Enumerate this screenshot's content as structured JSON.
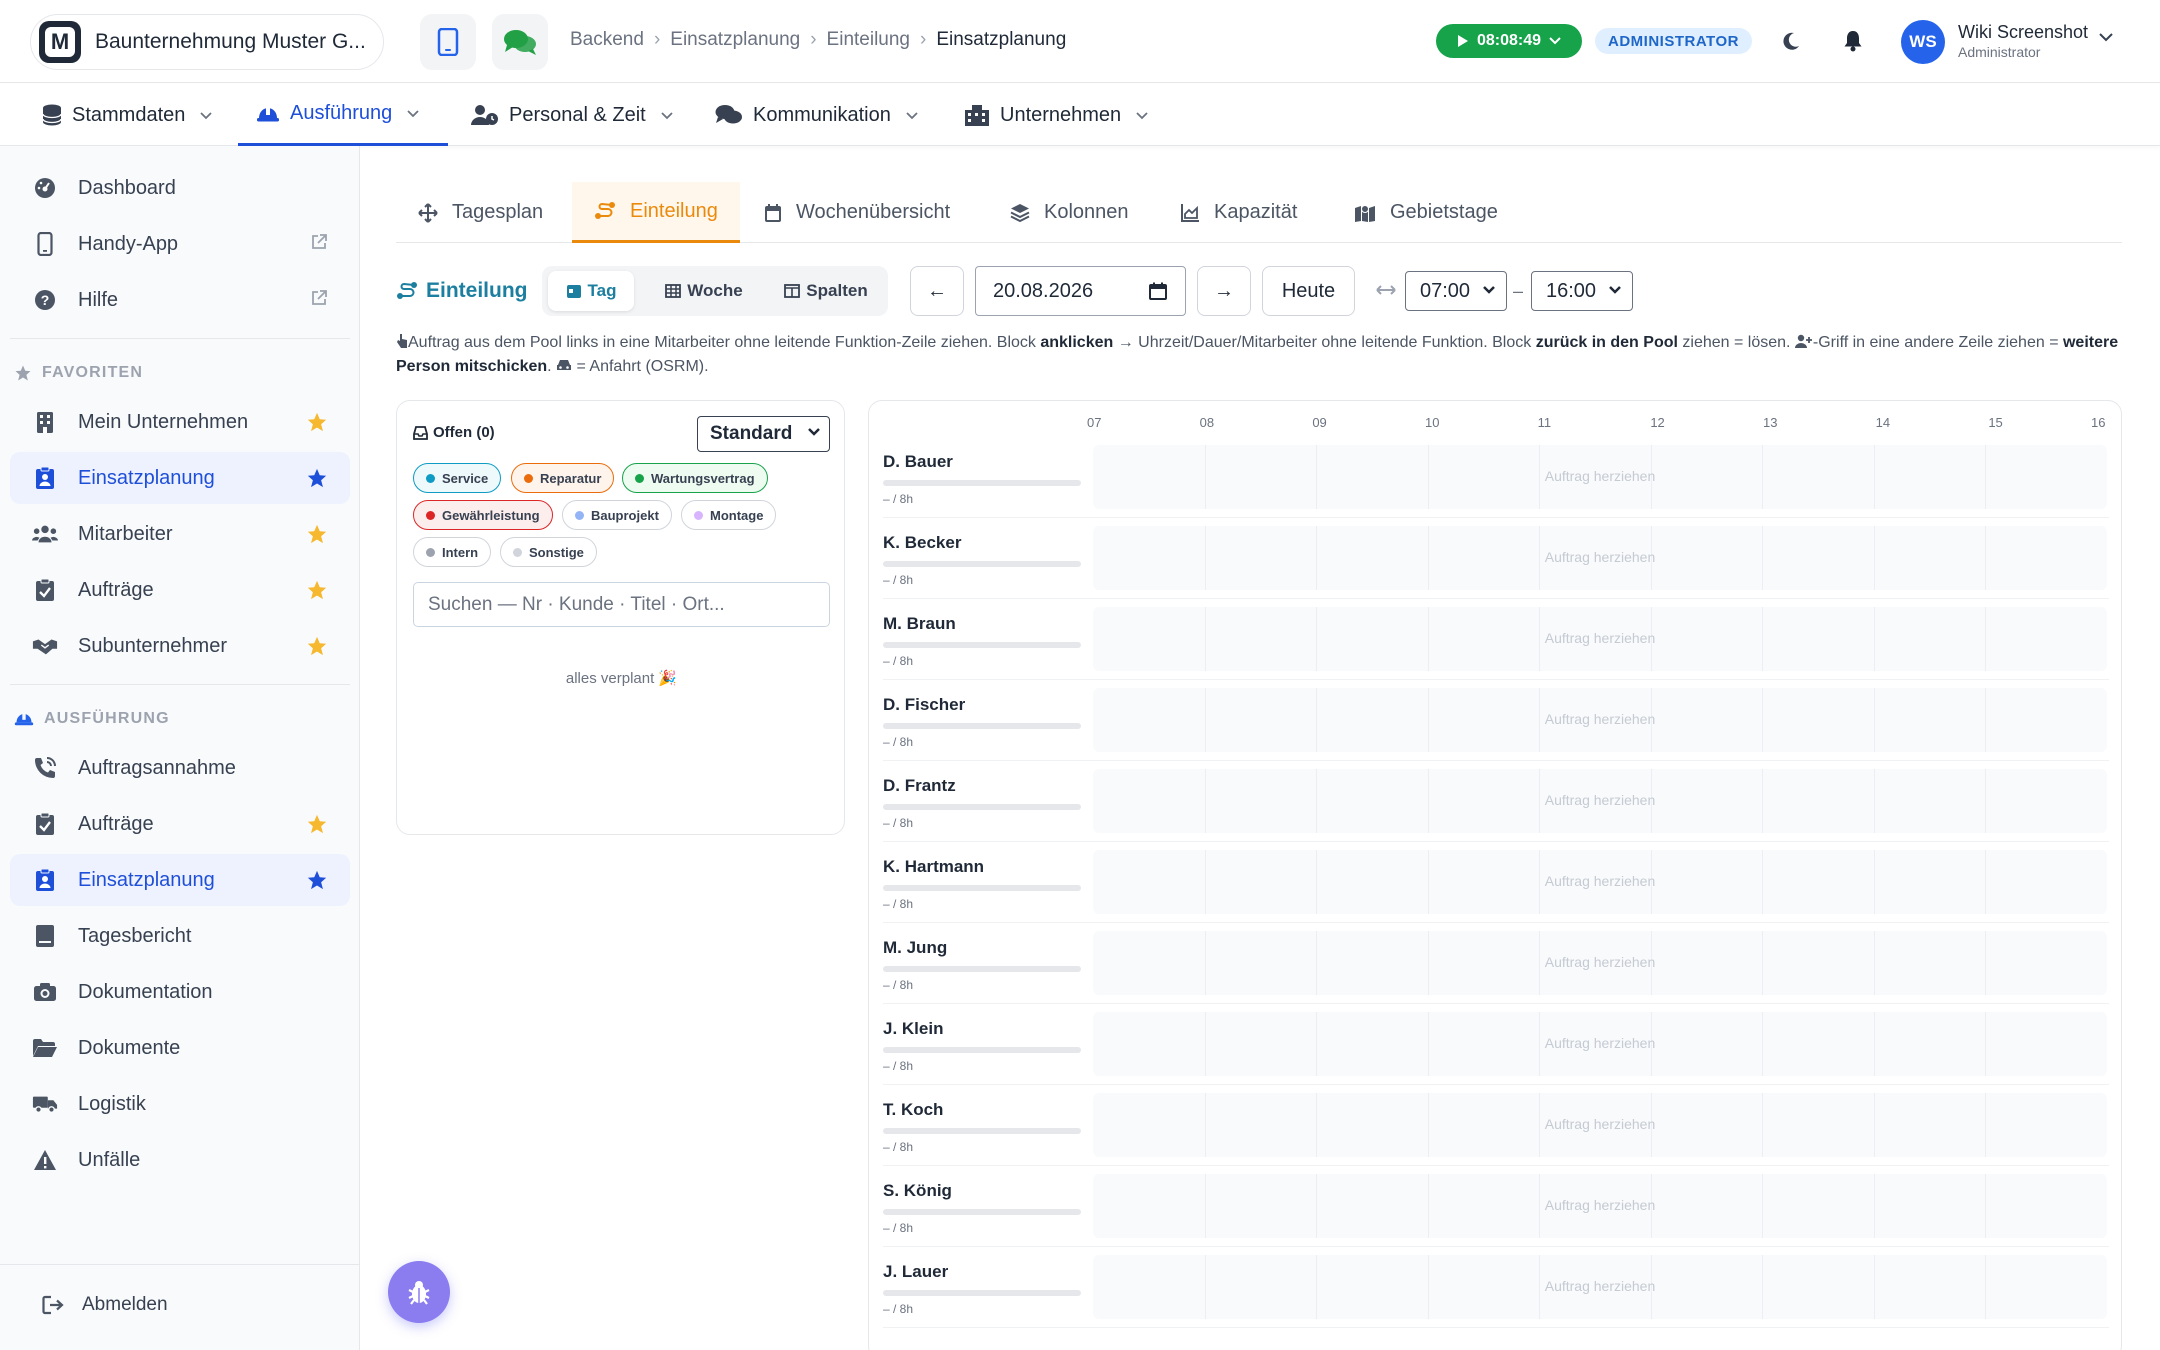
{
  "app": {
    "company_name": "Baunternehmung Muster G...",
    "logo_letter": "M"
  },
  "breadcrumb": [
    "Backend",
    "Einsatzplanung",
    "Einteilung",
    "Einsatzplanung"
  ],
  "header": {
    "timer": "08:08:49",
    "role_badge": "ADMINISTRATOR",
    "user_initials": "WS",
    "user_name": "Wiki Screenshot",
    "user_role": "Administrator"
  },
  "mainnav": [
    {
      "label": "Stammdaten",
      "icon": "database-icon",
      "active": false
    },
    {
      "label": "Ausführung",
      "icon": "helmet-icon",
      "active": true
    },
    {
      "label": "Personal & Zeit",
      "icon": "user-clock-icon",
      "active": false
    },
    {
      "label": "Kommunikation",
      "icon": "comments-icon",
      "active": false
    },
    {
      "label": "Unternehmen",
      "icon": "building-icon",
      "active": false
    }
  ],
  "sidebar": {
    "top": [
      {
        "label": "Dashboard",
        "icon": "gauge-icon"
      },
      {
        "label": "Handy-App",
        "icon": "phone-icon",
        "external": true
      },
      {
        "label": "Hilfe",
        "icon": "question-icon",
        "external": true
      }
    ],
    "favorites_heading": "FAVORITEN",
    "favorites": [
      {
        "label": "Mein Unternehmen",
        "icon": "building-icon",
        "star": "gold"
      },
      {
        "label": "Einsatzplanung",
        "icon": "clipboard-user-icon",
        "star": "blue",
        "active": true
      },
      {
        "label": "Mitarbeiter",
        "icon": "users-icon",
        "star": "gold"
      },
      {
        "label": "Aufträge",
        "icon": "clipboard-check-icon",
        "star": "gold"
      },
      {
        "label": "Subunternehmer",
        "icon": "handshake-icon",
        "star": "gold"
      }
    ],
    "section_heading": "AUSFÜHRUNG",
    "section": [
      {
        "label": "Auftragsannahme",
        "icon": "phone-volume-icon"
      },
      {
        "label": "Aufträge",
        "icon": "clipboard-check-icon",
        "star": "gold"
      },
      {
        "label": "Einsatzplanung",
        "icon": "clipboard-user-icon",
        "star": "blue",
        "active": true
      },
      {
        "label": "Tagesbericht",
        "icon": "report-icon"
      },
      {
        "label": "Dokumentation",
        "icon": "camera-icon"
      },
      {
        "label": "Dokumente",
        "icon": "folder-icon"
      },
      {
        "label": "Logistik",
        "icon": "truck-icon"
      },
      {
        "label": "Unfälle",
        "icon": "warning-icon"
      }
    ],
    "logout": "Abmelden"
  },
  "tabs": [
    {
      "label": "Tagesplan",
      "icon": "arrows-icon",
      "active": false
    },
    {
      "label": "Einteilung",
      "icon": "route-icon",
      "active": true
    },
    {
      "label": "Wochenübersicht",
      "icon": "calendar-icon",
      "active": false
    },
    {
      "label": "Kolonnen",
      "icon": "layers-icon",
      "active": false
    },
    {
      "label": "Kapazität",
      "icon": "chart-area-icon",
      "active": false
    },
    {
      "label": "Gebietstage",
      "icon": "map-icon",
      "active": false
    }
  ],
  "toolbar": {
    "title": "Einteilung",
    "views": [
      {
        "label": "Tag",
        "active": true
      },
      {
        "label": "Woche",
        "active": false
      },
      {
        "label": "Spalten",
        "active": false
      }
    ],
    "prev": "←",
    "date": "20.08.2026",
    "next": "→",
    "today": "Heute",
    "time_from": "07:00",
    "time_sep": "–",
    "time_to": "16:00"
  },
  "hint": {
    "p1": "Auftrag aus dem Pool links in eine Mitarbeiter ohne leitende Funktion-Zeile ziehen. Block ",
    "b1": "anklicken",
    "p2": " → Uhrzeit/Dauer/Mitarbeiter ohne leitende Funktion. Block ",
    "b2": "zurück in den Pool",
    "p3": " ziehen = lösen. ",
    "p4": "-Griff in eine andere Zeile ziehen = ",
    "b3": "weitere Person mitschicken",
    "p5": ". ",
    "p6": " = Anfahrt (OSRM)."
  },
  "pool": {
    "title": "Offen (0)",
    "filter": "Standard",
    "chips": [
      {
        "label": "Service",
        "color": "#0e9cc4",
        "border": "#0e9cc4",
        "bg": "#eef9fc"
      },
      {
        "label": "Reparatur",
        "color": "#ea6c0c",
        "border": "#ea6c0c",
        "bg": "#fff4ec"
      },
      {
        "label": "Wartungsvertrag",
        "color": "#16a34a",
        "border": "#16a34a",
        "bg": "#edfbf1"
      },
      {
        "label": "Gewährleistung",
        "color": "#dc2626",
        "border": "#dc2626",
        "bg": "#fdeeee"
      },
      {
        "label": "Bauprojekt",
        "color": "#93b4f5",
        "border": "#d1d5db",
        "bg": "#ffffff"
      },
      {
        "label": "Montage",
        "color": "#d8b4fe",
        "border": "#d1d5db",
        "bg": "#ffffff"
      },
      {
        "label": "Intern",
        "color": "#9ca3af",
        "border": "#d1d5db",
        "bg": "#ffffff"
      },
      {
        "label": "Sonstige",
        "color": "#d1d5db",
        "border": "#d1d5db",
        "bg": "#ffffff"
      }
    ],
    "search_placeholder": "Suchen — Nr · Kunde · Titel · Ort...",
    "empty": "alles verplant 🎉"
  },
  "schedule": {
    "hours": [
      "07",
      "08",
      "09",
      "10",
      "11",
      "12",
      "13",
      "14",
      "15",
      "16"
    ],
    "drop_label": "Auftrag herziehen",
    "employees": [
      {
        "name": "D. Bauer",
        "hours": "– / 8h"
      },
      {
        "name": "K. Becker",
        "hours": "– / 8h"
      },
      {
        "name": "M. Braun",
        "hours": "– / 8h"
      },
      {
        "name": "D. Fischer",
        "hours": "– / 8h"
      },
      {
        "name": "D. Frantz",
        "hours": "– / 8h"
      },
      {
        "name": "K. Hartmann",
        "hours": "– / 8h"
      },
      {
        "name": "M. Jung",
        "hours": "– / 8h"
      },
      {
        "name": "J. Klein",
        "hours": "– / 8h"
      },
      {
        "name": "T. Koch",
        "hours": "– / 8h"
      },
      {
        "name": "S. König",
        "hours": "– / 8h"
      },
      {
        "name": "J. Lauer",
        "hours": "– / 8h"
      }
    ]
  }
}
